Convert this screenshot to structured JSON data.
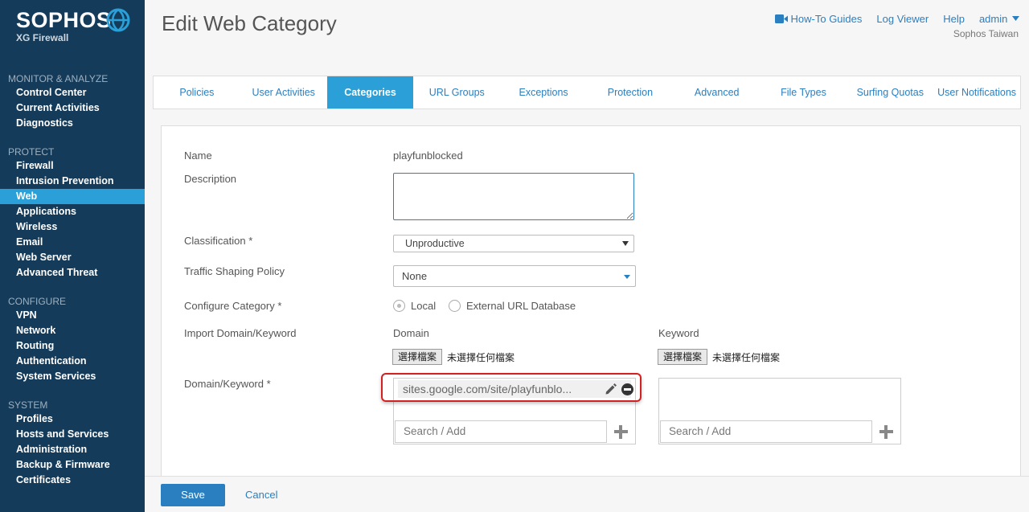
{
  "brand": {
    "name": "SOPHOS",
    "product": "XG Firewall"
  },
  "sidebar": {
    "sections": [
      {
        "title": "MONITOR & ANALYZE",
        "items": [
          "Control Center",
          "Current Activities",
          "Diagnostics"
        ]
      },
      {
        "title": "PROTECT",
        "items": [
          "Firewall",
          "Intrusion Prevention",
          "Web",
          "Applications",
          "Wireless",
          "Email",
          "Web Server",
          "Advanced Threat"
        ]
      },
      {
        "title": "CONFIGURE",
        "items": [
          "VPN",
          "Network",
          "Routing",
          "Authentication",
          "System Services"
        ]
      },
      {
        "title": "SYSTEM",
        "items": [
          "Profiles",
          "Hosts and Services",
          "Administration",
          "Backup & Firmware",
          "Certificates"
        ]
      }
    ],
    "active_item": "Web"
  },
  "header": {
    "title": "Edit Web Category",
    "links": {
      "howto": "How-To Guides",
      "log": "Log Viewer",
      "help": "Help",
      "admin": "admin"
    },
    "org": "Sophos Taiwan"
  },
  "tabs": [
    "Policies",
    "User Activities",
    "Categories",
    "URL Groups",
    "Exceptions",
    "Protection",
    "Advanced",
    "File Types",
    "Surfing Quotas",
    "User Notifications"
  ],
  "active_tab": "Categories",
  "form": {
    "name_label": "Name",
    "name_value": "playfunblocked",
    "description_label": "Description",
    "description_value": "",
    "classification_label": "Classification *",
    "classification_value": "Unproductive",
    "traffic_label": "Traffic Shaping Policy",
    "traffic_value": "None",
    "configure_label": "Configure Category *",
    "configure_options": [
      "Local",
      "External URL Database"
    ],
    "configure_selected": "Local",
    "import_label": "Import Domain/Keyword",
    "domain_header": "Domain",
    "keyword_header": "Keyword",
    "file_button": "選擇檔案",
    "file_none": "未選擇任何檔案",
    "domain_keyword_label": "Domain/Keyword *",
    "domain_entries": [
      "sites.google.com/site/playfunblo..."
    ],
    "search_placeholder": "Search / Add"
  },
  "footer": {
    "save": "Save",
    "cancel": "Cancel"
  },
  "colors": {
    "sidebar": "#143b59",
    "accent": "#2a9fd8",
    "link": "#2a7fc0",
    "highlight": "#d32020"
  }
}
